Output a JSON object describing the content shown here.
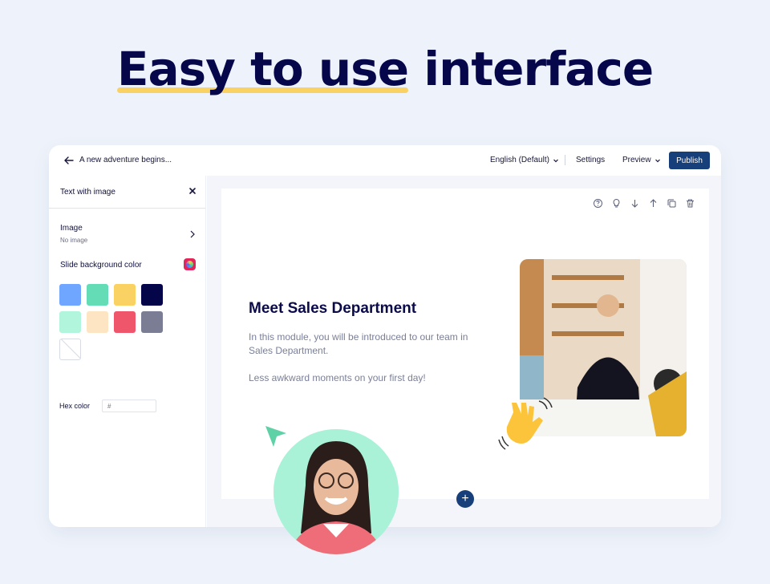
{
  "headline": {
    "part1": "Easy to use",
    "part2": "interface"
  },
  "topbar": {
    "doc_title": "A new adventure begins...",
    "language": "English (Default)",
    "settings": "Settings",
    "preview": "Preview",
    "publish": "Publish"
  },
  "sidebar": {
    "title": "Text with image",
    "image_label": "Image",
    "image_value": "No image",
    "bg_label": "Slide background color",
    "swatches": [
      "#6fa6ff",
      "#64ddb6",
      "#fad264",
      "#05064a",
      "#b2f5dd",
      "#fde5c4",
      "#f0566b",
      "#7a7d93",
      "none"
    ],
    "hex_label": "Hex color",
    "hex_placeholder": "#"
  },
  "slide": {
    "title": "Meet Sales Department",
    "body": "In this module, you will be introduced to our team in Sales Department.",
    "body2": "Less awkward moments on your first day!"
  },
  "icons": [
    "help-icon",
    "bulb-icon",
    "arrow-down-icon",
    "arrow-up-icon",
    "copy-icon",
    "trash-icon"
  ],
  "colors": {
    "accent": "#173f7a",
    "highlight": "#fad264",
    "background": "#eef3fb"
  }
}
